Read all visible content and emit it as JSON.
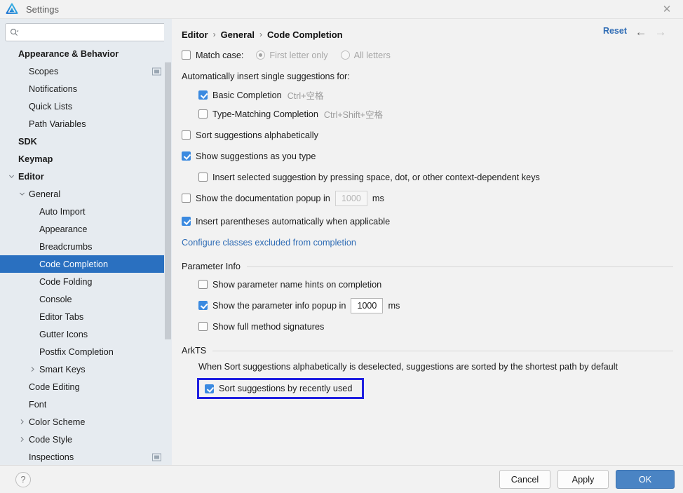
{
  "window": {
    "title": "Settings",
    "logo_icon": "deveco-logo-icon",
    "close_icon": "✕"
  },
  "sidebar": {
    "search": {
      "placeholder": "",
      "value": "",
      "icon": "search-icon"
    },
    "items": [
      {
        "label": "Appearance & Behavior",
        "depth": 0,
        "bold": true,
        "twisty": "",
        "selected": false,
        "badge": false
      },
      {
        "label": "Scopes",
        "depth": 1,
        "bold": false,
        "twisty": "",
        "selected": false,
        "badge": true
      },
      {
        "label": "Notifications",
        "depth": 1,
        "bold": false,
        "twisty": "",
        "selected": false,
        "badge": false
      },
      {
        "label": "Quick Lists",
        "depth": 1,
        "bold": false,
        "twisty": "",
        "selected": false,
        "badge": false
      },
      {
        "label": "Path Variables",
        "depth": 1,
        "bold": false,
        "twisty": "",
        "selected": false,
        "badge": false
      },
      {
        "label": "SDK",
        "depth": 0,
        "bold": true,
        "twisty": "",
        "selected": false,
        "badge": false
      },
      {
        "label": "Keymap",
        "depth": 0,
        "bold": true,
        "twisty": "",
        "selected": false,
        "badge": false
      },
      {
        "label": "Editor",
        "depth": 0,
        "bold": true,
        "twisty": "v",
        "selected": false,
        "badge": false
      },
      {
        "label": "General",
        "depth": 1,
        "bold": false,
        "twisty": "v",
        "selected": false,
        "badge": false
      },
      {
        "label": "Auto Import",
        "depth": 2,
        "bold": false,
        "twisty": "",
        "selected": false,
        "badge": false
      },
      {
        "label": "Appearance",
        "depth": 2,
        "bold": false,
        "twisty": "",
        "selected": false,
        "badge": false
      },
      {
        "label": "Breadcrumbs",
        "depth": 2,
        "bold": false,
        "twisty": "",
        "selected": false,
        "badge": false
      },
      {
        "label": "Code Completion",
        "depth": 2,
        "bold": false,
        "twisty": "",
        "selected": true,
        "badge": false
      },
      {
        "label": "Code Folding",
        "depth": 2,
        "bold": false,
        "twisty": "",
        "selected": false,
        "badge": false
      },
      {
        "label": "Console",
        "depth": 2,
        "bold": false,
        "twisty": "",
        "selected": false,
        "badge": false
      },
      {
        "label": "Editor Tabs",
        "depth": 2,
        "bold": false,
        "twisty": "",
        "selected": false,
        "badge": false
      },
      {
        "label": "Gutter Icons",
        "depth": 2,
        "bold": false,
        "twisty": "",
        "selected": false,
        "badge": false
      },
      {
        "label": "Postfix Completion",
        "depth": 2,
        "bold": false,
        "twisty": "",
        "selected": false,
        "badge": false
      },
      {
        "label": "Smart Keys",
        "depth": 2,
        "bold": false,
        "twisty": ">",
        "selected": false,
        "badge": false
      },
      {
        "label": "Code Editing",
        "depth": 1,
        "bold": false,
        "twisty": "",
        "selected": false,
        "badge": false
      },
      {
        "label": "Font",
        "depth": 1,
        "bold": false,
        "twisty": "",
        "selected": false,
        "badge": false
      },
      {
        "label": "Color Scheme",
        "depth": 1,
        "bold": false,
        "twisty": ">",
        "selected": false,
        "badge": false
      },
      {
        "label": "Code Style",
        "depth": 1,
        "bold": false,
        "twisty": ">",
        "selected": false,
        "badge": false
      },
      {
        "label": "Inspections",
        "depth": 1,
        "bold": false,
        "twisty": "",
        "selected": false,
        "badge": true
      }
    ]
  },
  "header": {
    "breadcrumb": [
      "Editor",
      "General",
      "Code Completion"
    ],
    "separator": "›",
    "reset_label": "Reset",
    "back_icon": "←",
    "forward_icon": "→"
  },
  "main": {
    "match_case": {
      "label": "Match case:",
      "checked": false
    },
    "match_case_options": [
      {
        "label": "First letter only",
        "selected": true,
        "disabled": true
      },
      {
        "label": "All letters",
        "selected": false,
        "disabled": true
      }
    ],
    "auto_insert_heading": "Automatically insert single suggestions for:",
    "auto_insert_items": [
      {
        "label": "Basic Completion",
        "shortcut": "Ctrl+空格",
        "checked": true
      },
      {
        "label": "Type-Matching Completion",
        "shortcut": "Ctrl+Shift+空格",
        "checked": false
      }
    ],
    "sort_alpha": {
      "label": "Sort suggestions alphabetically",
      "checked": false
    },
    "show_as_you_type": {
      "label": "Show suggestions as you type",
      "checked": true
    },
    "insert_selected": {
      "label": "Insert selected suggestion by pressing space, dot, or other context-dependent keys",
      "checked": false
    },
    "doc_popup": {
      "label_before": "Show the documentation popup in",
      "value": "1000",
      "label_after": "ms",
      "checked": false,
      "field_disabled": true
    },
    "insert_parens": {
      "label": "Insert parentheses automatically when applicable",
      "checked": true
    },
    "configure_link": "Configure classes excluded from completion",
    "parameter_info": {
      "title": "Parameter Info",
      "show_hints": {
        "label": "Show parameter name hints on completion",
        "checked": false
      },
      "popup": {
        "label_before": "Show the parameter info popup in",
        "value": "1000",
        "label_after": "ms",
        "checked": true,
        "field_disabled": false
      },
      "full_signatures": {
        "label": "Show full method signatures",
        "checked": false
      }
    },
    "arkts": {
      "title": "ArkTS",
      "note": "When Sort suggestions alphabetically is deselected, suggestions are sorted by the shortest path by default",
      "sort_recent": {
        "label": "Sort suggestions by recently used",
        "checked": true
      },
      "focus_border_color": "#1f1fe0"
    }
  },
  "footer": {
    "help_icon": "?",
    "buttons": [
      {
        "label": "Cancel",
        "primary": false
      },
      {
        "label": "Apply",
        "primary": false
      },
      {
        "label": "OK",
        "primary": true
      }
    ]
  },
  "colors": {
    "accent": "#2a70c0",
    "link": "#2f6cb5",
    "checkbox_checked": "#3b8ae0",
    "sidebar_bg": "#e6ebf0",
    "main_bg": "#f2f2f2"
  }
}
